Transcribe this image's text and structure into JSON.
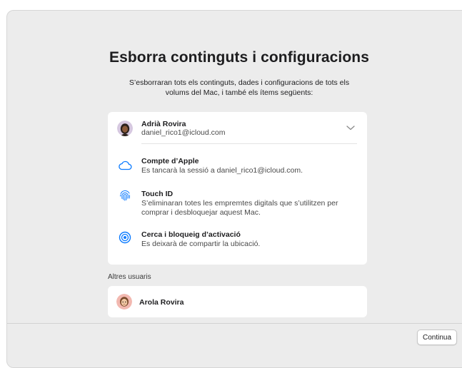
{
  "dialog": {
    "title": "Esborra continguts i configuracions",
    "subtitle_line1": "S’esborraran tots els continguts, dades i configuracions de tots els",
    "subtitle_line2": "volums del Mac, i també els ítems següents:"
  },
  "account": {
    "name": "Adrià Rovira",
    "email": "daniel_rico1@icloud.com"
  },
  "items": [
    {
      "icon": "icloud-icon",
      "title": "Compte d’Apple",
      "desc": [
        "Es tancarà la sessió a daniel_rico1@icloud.com."
      ]
    },
    {
      "icon": "touch-id-icon",
      "title": "Touch ID",
      "desc": [
        "S’eliminaran totes les empremtes digitals que s’utilitzen per",
        "comprar i desbloquejar aquest Mac."
      ]
    },
    {
      "icon": "find-my-icon",
      "title": "Cerca i bloqueig d’activació",
      "desc": [
        "Es deixarà de compartir la ubicació."
      ]
    }
  ],
  "other_users": {
    "label": "Altres usuaris",
    "users": [
      {
        "name": "Arola Rovira"
      }
    ]
  },
  "footer": {
    "continue_label": "Continua"
  },
  "colors": {
    "accent": "#0a7aff",
    "window_bg": "#ececec",
    "card_bg": "#ffffff"
  }
}
